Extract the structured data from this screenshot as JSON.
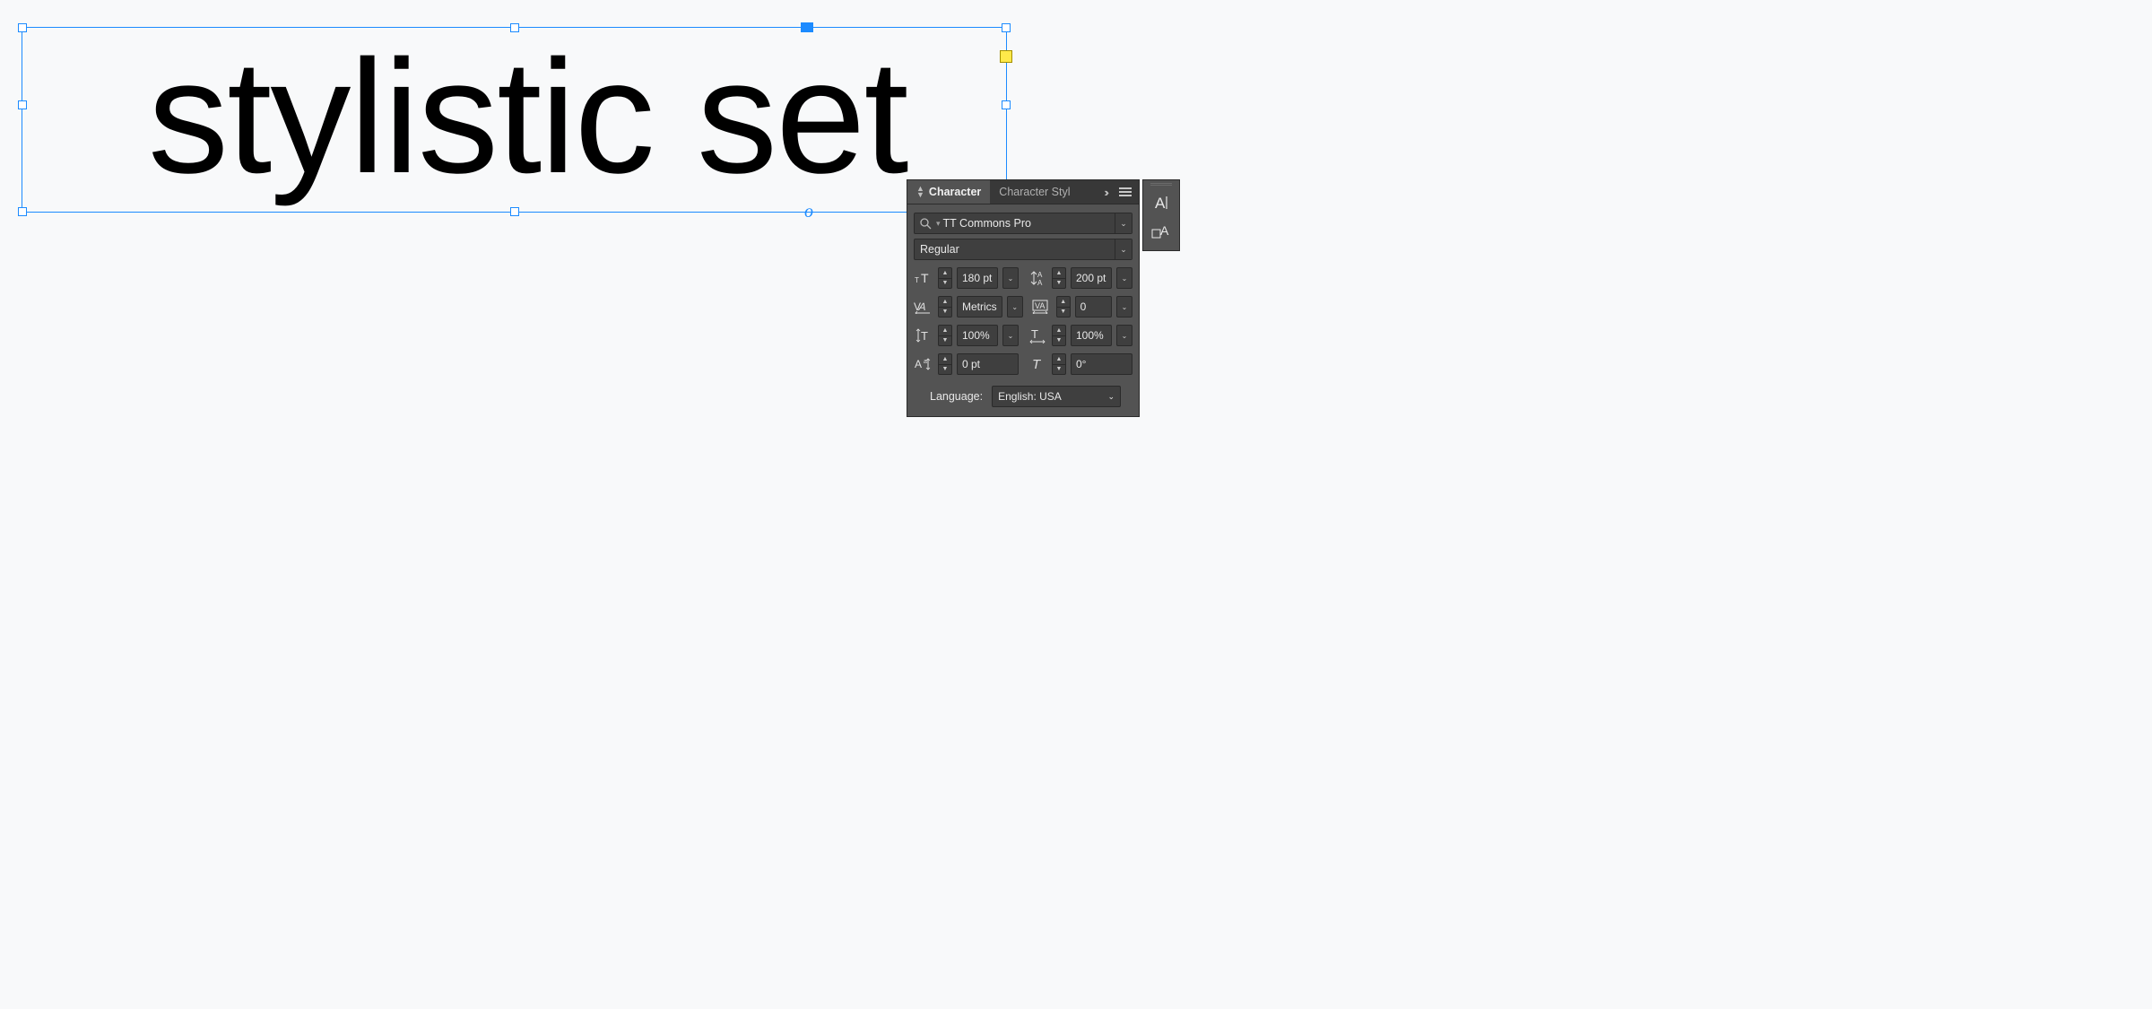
{
  "canvas": {
    "text": "stylistic set",
    "baseline_marker": "o"
  },
  "panel": {
    "tabs": {
      "character": "Character",
      "char_styles": "Character Styl"
    },
    "font_family": "TT Commons Pro",
    "font_style": "Regular",
    "font_size": "180 pt",
    "leading": "200 pt",
    "kerning": "Metrics",
    "tracking": "0",
    "vertical_scale": "100%",
    "horizontal_scale": "100%",
    "baseline_shift": "0 pt",
    "skew": "0°",
    "language_label": "Language:",
    "language_value": "English: USA"
  }
}
